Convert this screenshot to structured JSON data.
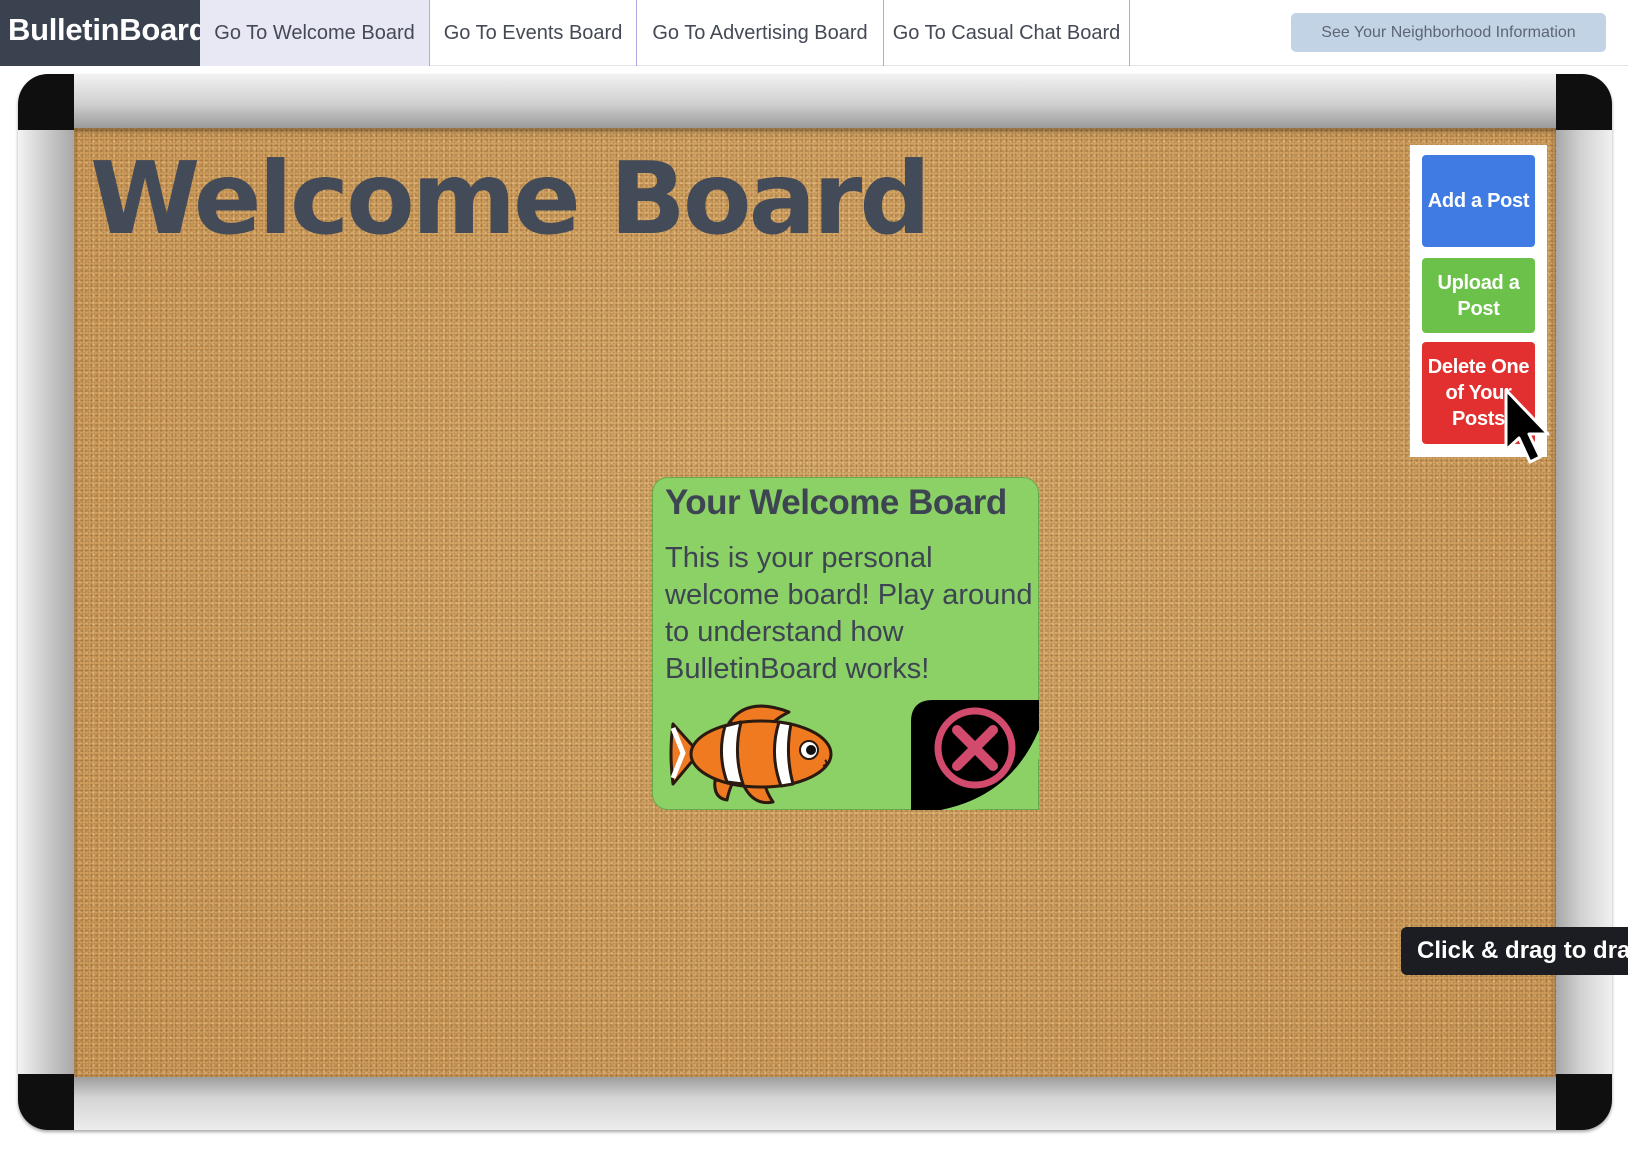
{
  "nav": {
    "brand": "BulletinBoard",
    "tabs": [
      {
        "label": "Go To Welcome Board",
        "active": true
      },
      {
        "label": "Go To Events Board",
        "active": false
      },
      {
        "label": "Go To Advertising Board",
        "active": false
      },
      {
        "label": "Go To Casual Chat Board",
        "active": false
      }
    ],
    "neighborhood_button": "See Your Neighborhood Information"
  },
  "board": {
    "title": "Welcome Board"
  },
  "actions": {
    "add_label": "Add a Post",
    "upload_label": "Upload a Post",
    "delete_label": "Delete One of Your Posts"
  },
  "note": {
    "title": "Your Welcome Board",
    "body": "This is your personal welcome board! Play around to understand how BulletinBoard works!",
    "image_icon": "clownfish-image",
    "close_icon": "close-circle-icon"
  },
  "tooltip": {
    "text": "Click & drag to dra"
  },
  "colors": {
    "brand_bg": "#3a4250",
    "add_button": "#3f7be2",
    "upload_button": "#6cc14a",
    "delete_button": "#e1302f",
    "note_bg": "#8bd166",
    "cork": "#d9a866"
  }
}
